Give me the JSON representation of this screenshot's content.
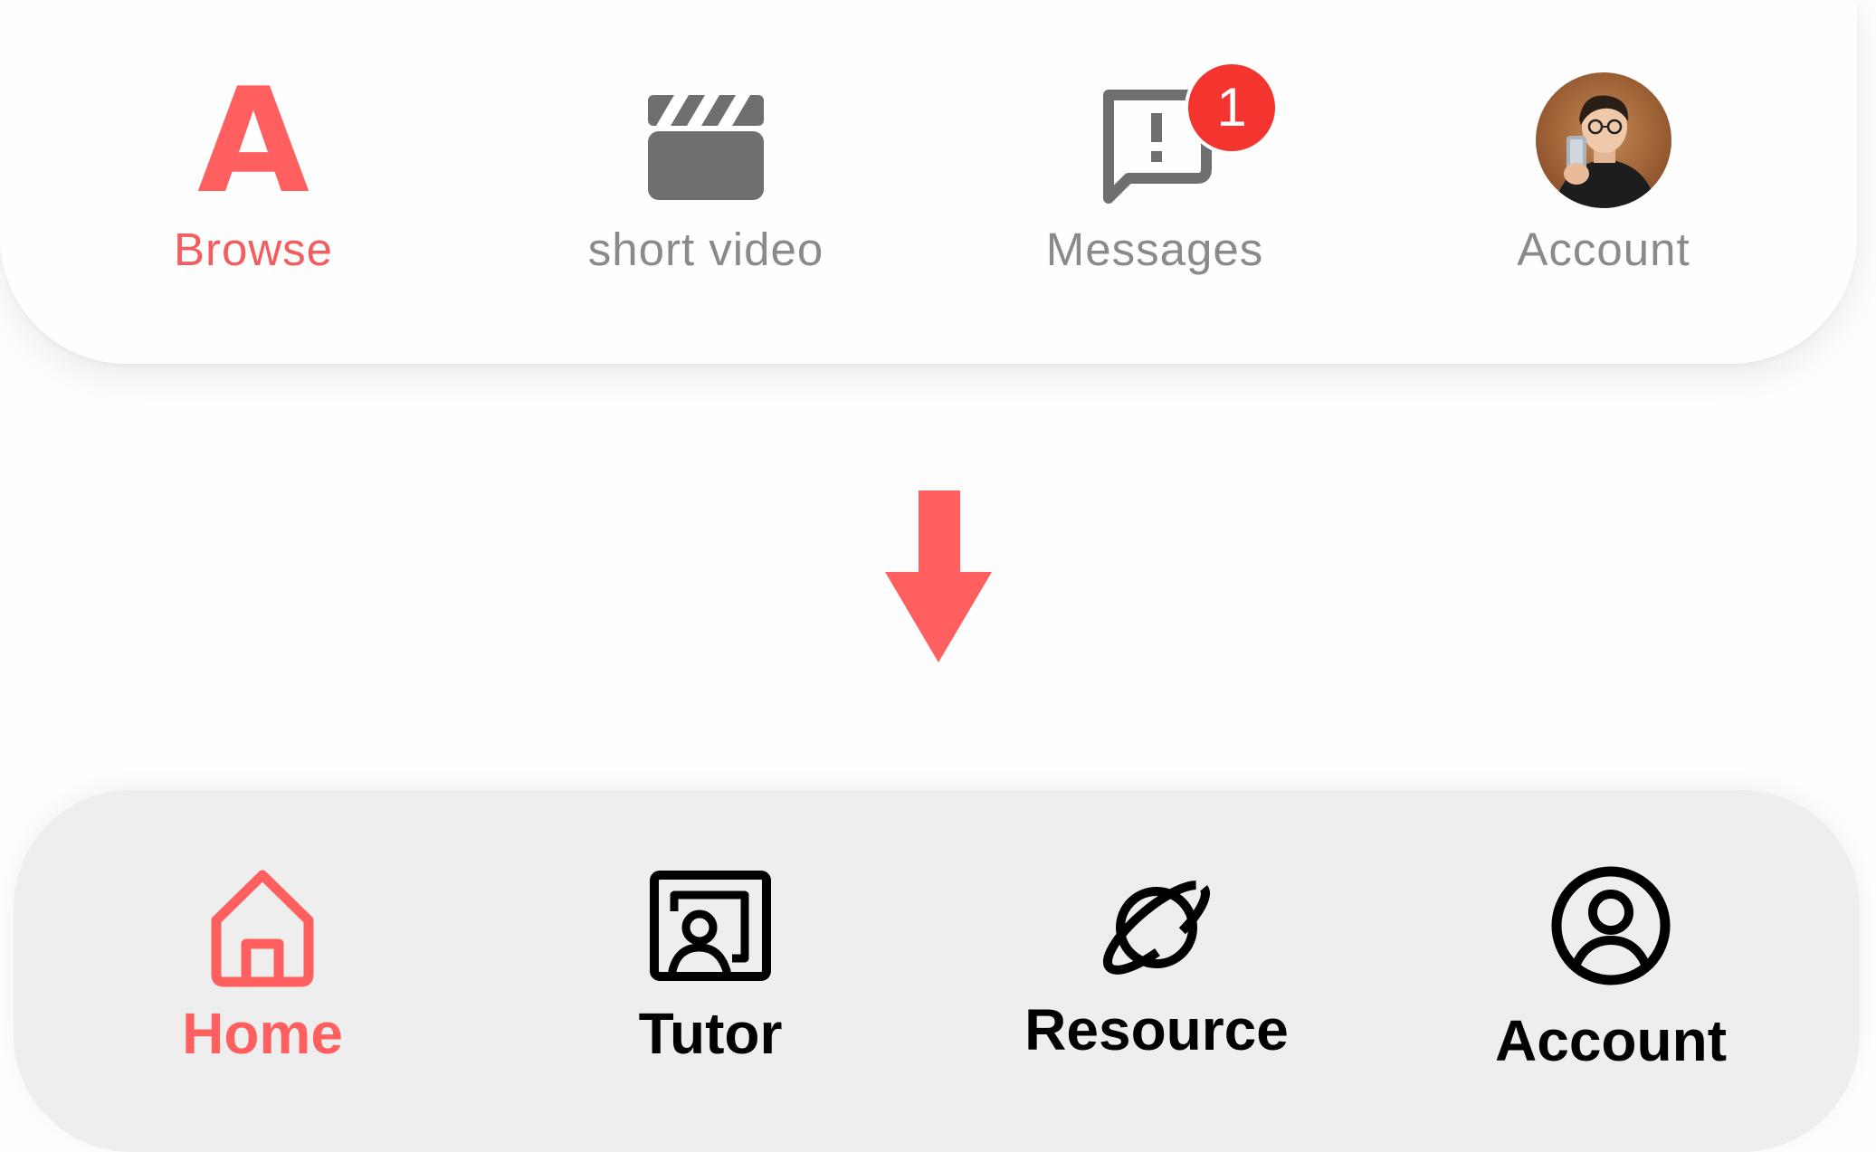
{
  "top_bar": {
    "items": [
      {
        "label": "Browse",
        "icon": "letter-a-icon",
        "active": true
      },
      {
        "label": "short video",
        "icon": "clapperboard-icon",
        "active": false
      },
      {
        "label": "Messages",
        "icon": "message-alert-icon",
        "active": false,
        "badge": "1"
      },
      {
        "label": "Account",
        "icon": "avatar-photo",
        "active": false
      }
    ],
    "brand_letter": "A"
  },
  "transition": {
    "icon": "arrow-down-icon"
  },
  "bottom_bar": {
    "items": [
      {
        "label": "Home",
        "icon": "home-icon",
        "active": true
      },
      {
        "label": "Tutor",
        "icon": "tutor-icon",
        "active": false
      },
      {
        "label": "Resource",
        "icon": "planet-icon",
        "active": false
      },
      {
        "label": "Account",
        "icon": "user-circle-icon",
        "active": false
      }
    ]
  },
  "colors": {
    "accent": "#ff5f5f",
    "inactive_top": "#8a8a8a",
    "badge": "#f4342f",
    "bottom_bg": "#eeeeee",
    "bottom_label": "#000000"
  }
}
